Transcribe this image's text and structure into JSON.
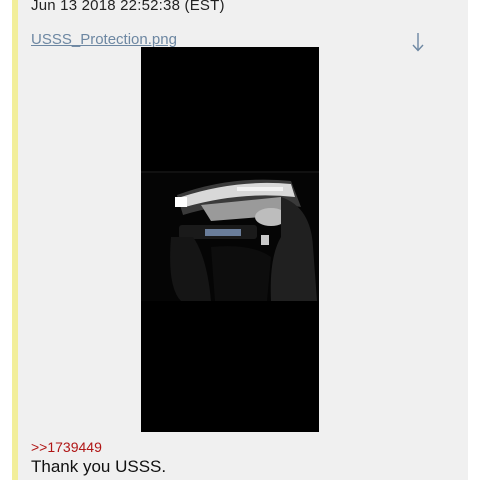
{
  "post": {
    "timestamp": "Jun 13 2018 22:52:38 (EST)",
    "file_name": "USSS_Protection.png",
    "download_icon": "download-arrow-icon",
    "reply_link": ">>1739449",
    "message": "Thank you USSS."
  },
  "image": {
    "description_icon": "night-car-interior-photo",
    "accent_colors": {
      "border": "#f2ee9a",
      "link": "#6d87a2",
      "reply": "#b01515",
      "background": "#f0f0f0"
    }
  }
}
